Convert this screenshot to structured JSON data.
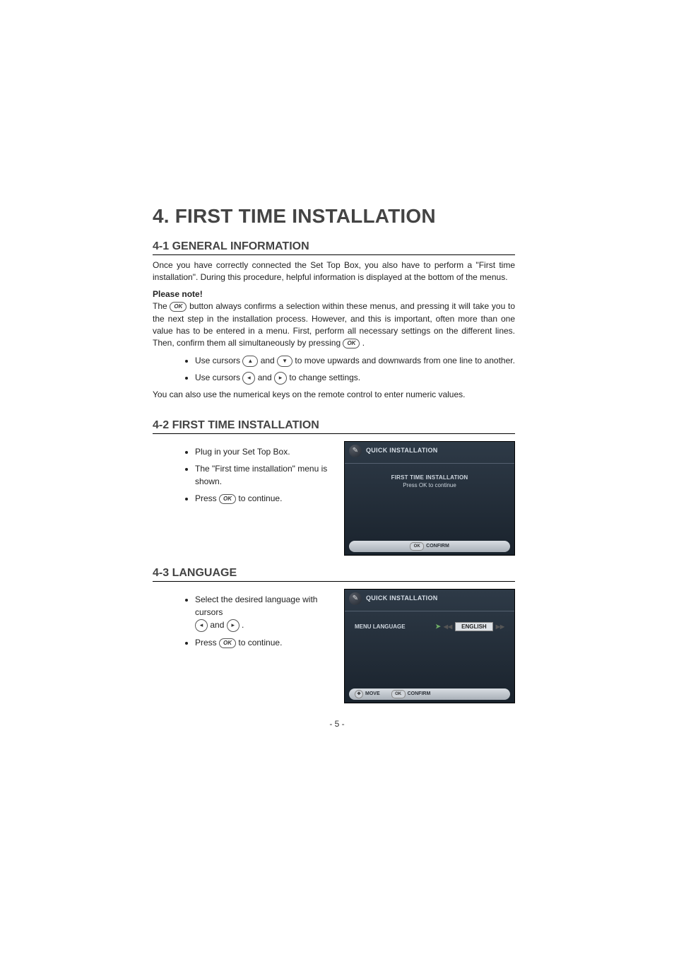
{
  "title": "4. FIRST TIME INSTALLATION",
  "sec41": {
    "heading": "4-1 GENERAL INFORMATION",
    "para1": "Once you have correctly connected the Set Top Box, you also have to perform a \"First time installation\". During this procedure, helpful information is displayed at the bottom of the menus.",
    "note_label": "Please note!",
    "para2a": "The ",
    "para2b": " button always confirms a selection within these menus, and pressing it will take you to the next step in the installation process. However, and this is important, often more than one value has to be entered in a menu. First, perform all necessary settings on the different lines. Then, confirm them all simultaneously by pressing ",
    "para2c": ".",
    "bullet1a": "Use cursors ",
    "bullet1b": " and ",
    "bullet1c": " to move upwards and downwards from one line to another.",
    "bullet2a": "Use cursors ",
    "bullet2b": " and ",
    "bullet2c": " to change settings.",
    "para3": "You can also use the numerical keys on the remote control to enter numeric values."
  },
  "sec42": {
    "heading": "4-2 FIRST TIME INSTALLATION",
    "b1": "Plug in your Set Top Box.",
    "b2": "The \"First time installation\" menu is shown.",
    "b3a": "Press ",
    "b3b": " to continue.",
    "osd": {
      "title": "QUICK INSTALLATION",
      "line1": "FIRST TIME INSTALLATION",
      "line2": "Press OK to continue",
      "confirm": "CONFIRM",
      "ok": "OK"
    }
  },
  "sec43": {
    "heading": "4-3 LANGUAGE",
    "b1a": "Select the desired language with cursors ",
    "b1b": " and ",
    "b1c": ".",
    "b2a": "Press ",
    "b2b": " to continue.",
    "osd": {
      "title": "QUICK INSTALLATION",
      "label": "MENU LANGUAGE",
      "value": "ENGLISH",
      "move": "MOVE",
      "confirm": "CONFIRM",
      "ok": "OK"
    }
  },
  "ok_label": "OK",
  "page_number": "- 5 -"
}
